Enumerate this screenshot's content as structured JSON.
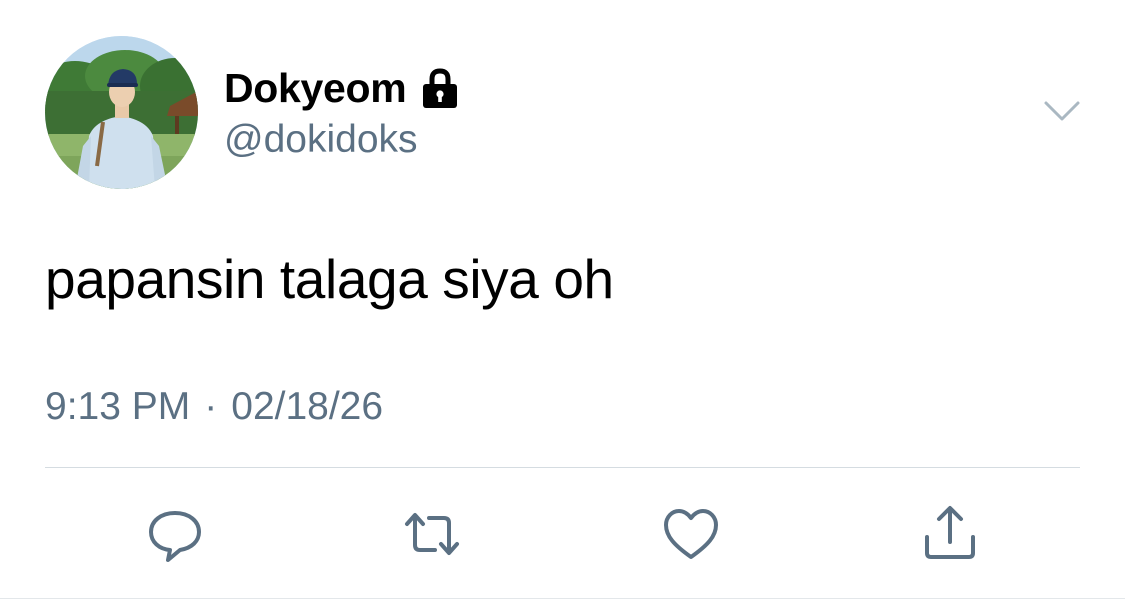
{
  "author": {
    "display_name": "Dokyeom",
    "handle": "@dokidoks",
    "protected_icon": "lock-icon",
    "avatar_icon": "profile-photo"
  },
  "tweet": {
    "text": "papansin talaga siya oh",
    "time": "9:13 PM",
    "separator": "·",
    "date": "02/18/26"
  },
  "actions": [
    {
      "icon": "reply-icon"
    },
    {
      "icon": "retweet-icon"
    },
    {
      "icon": "like-icon"
    },
    {
      "icon": "share-icon"
    }
  ],
  "menu_icon": "chevron-down-icon",
  "colors": {
    "text": "#000000",
    "secondary": "#5b7083",
    "divider": "#d5dce1",
    "icon": "#5b7083"
  }
}
